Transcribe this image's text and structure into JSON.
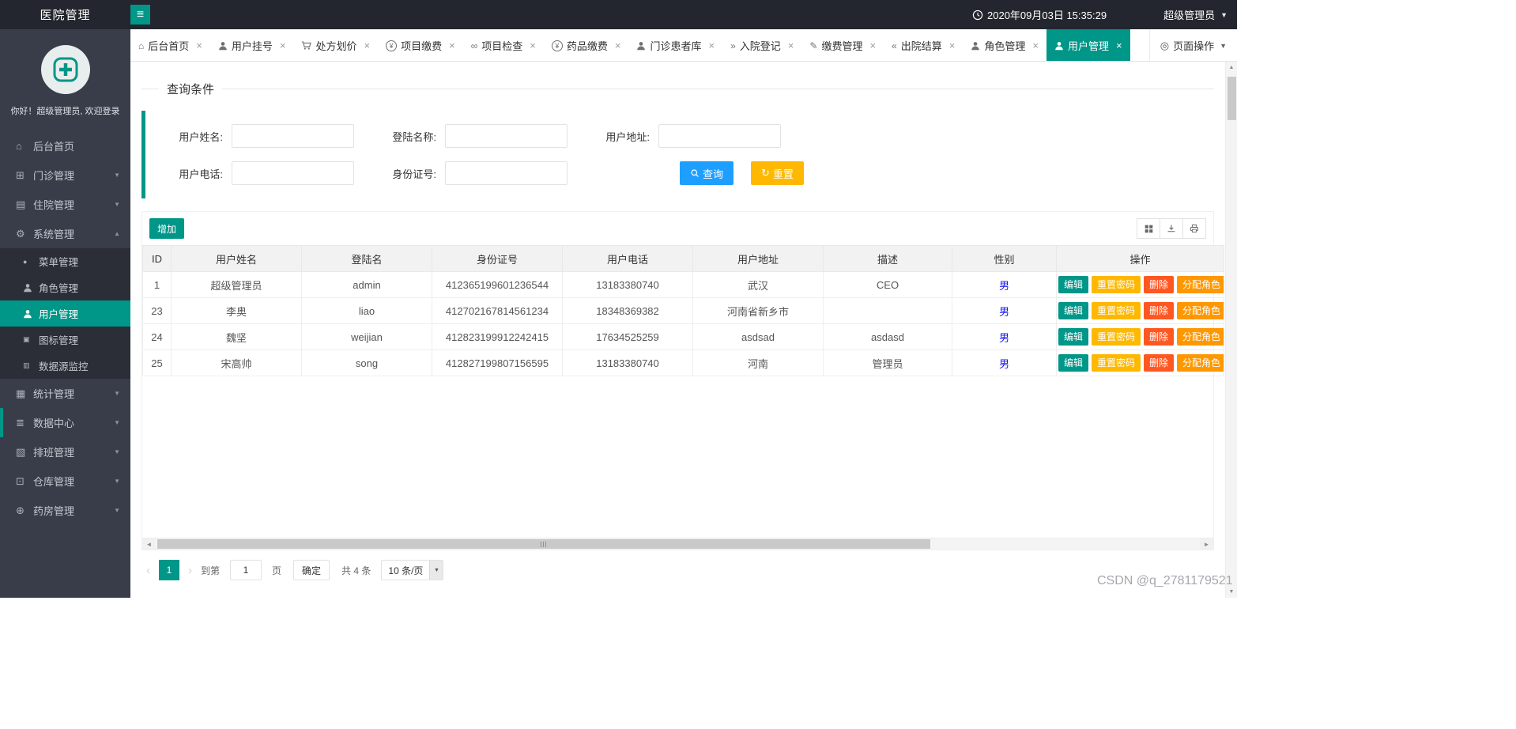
{
  "colors": {
    "accent": "#009688",
    "topbar_bg": "#23262E",
    "sidebar_bg": "#393D49",
    "search_blue": "#1E9FFF",
    "warn_yellow": "#FFB800",
    "danger_red": "#FF5722",
    "role_orange": "#FF9800",
    "gender_blue": "#1717EE"
  },
  "topbar": {
    "app_title": "医院管理",
    "hamburger_glyph": "≡",
    "datetime": "2020年09月03日 15:35:29",
    "username": "超级管理员",
    "caret_down": "▼"
  },
  "sidebar": {
    "greeting": "你好！超级管理员, 欢迎登录",
    "items": [
      {
        "label": "后台首页",
        "icon": "home-icon",
        "glyph": "⌂",
        "caret": ""
      },
      {
        "label": "门诊管理",
        "icon": "outpatient-icon",
        "glyph": "⊞",
        "caret": "▼"
      },
      {
        "label": "住院管理",
        "icon": "inpatient-icon",
        "glyph": "▤",
        "caret": "▼"
      },
      {
        "label": "系统管理",
        "icon": "gear-icon",
        "glyph": "⚙",
        "caret": "▲"
      },
      {
        "label": "统计管理",
        "icon": "chart-icon",
        "glyph": "▦",
        "caret": "▼"
      },
      {
        "label": "数据中心",
        "icon": "database-icon",
        "glyph": "≣",
        "caret": "▼"
      },
      {
        "label": "排班管理",
        "icon": "schedule-icon",
        "glyph": "▧",
        "caret": "▼"
      },
      {
        "label": "仓库管理",
        "icon": "warehouse-icon",
        "glyph": "⊡",
        "caret": "▼"
      },
      {
        "label": "药房管理",
        "icon": "pharmacy-icon",
        "glyph": "⊕",
        "caret": "▼"
      }
    ],
    "system_children": [
      {
        "label": "菜单管理",
        "icon": "dot-icon",
        "glyph": "●"
      },
      {
        "label": "角色管理",
        "icon": "role-icon"
      },
      {
        "label": "用户管理",
        "icon": "user-icon",
        "active": true
      },
      {
        "label": "图标管理",
        "icon": "image-icon",
        "glyph": "▣"
      },
      {
        "label": "数据源监控",
        "icon": "monitor-icon",
        "glyph": "▥"
      }
    ]
  },
  "tabbar": {
    "close_glyph": "×",
    "tabs": [
      {
        "label": "后台首页",
        "icon": "home-icon",
        "glyph": "⌂"
      },
      {
        "label": "用户挂号",
        "icon": "user-icon"
      },
      {
        "label": "处方划价",
        "icon": "cart-icon"
      },
      {
        "label": "项目缴费",
        "icon": "yen-icon",
        "glyph": "¥"
      },
      {
        "label": "项目检查",
        "icon": "link-icon",
        "glyph": "∞"
      },
      {
        "label": "药品缴费",
        "icon": "yen-icon",
        "glyph": "¥"
      },
      {
        "label": "门诊患者库",
        "icon": "patients-icon"
      },
      {
        "label": "入院登记",
        "icon": "admit-icon",
        "glyph": "»"
      },
      {
        "label": "缴费管理",
        "icon": "form-icon",
        "glyph": "✎"
      },
      {
        "label": "出院结算",
        "icon": "discharge-icon",
        "glyph": "«"
      },
      {
        "label": "角色管理",
        "icon": "role-icon"
      },
      {
        "label": "用户管理",
        "icon": "user-icon",
        "active": true
      }
    ],
    "page_ops": {
      "label": "页面操作",
      "icon": "target-icon",
      "glyph": "◎",
      "caret": "▼"
    }
  },
  "query": {
    "section_title": "查询条件",
    "fields": [
      {
        "label": "用户姓名:",
        "value": ""
      },
      {
        "label": "登陆名称:",
        "value": ""
      },
      {
        "label": "用户地址:",
        "value": ""
      },
      {
        "label": "用户电话:",
        "value": ""
      },
      {
        "label": "身份证号:",
        "value": ""
      }
    ],
    "search_button": "查询",
    "reset_button": "重置",
    "reset_glyph": "↻"
  },
  "toolbar": {
    "add_button": "增加"
  },
  "table": {
    "headers": [
      "ID",
      "用户姓名",
      "登陆名",
      "身份证号",
      "用户电话",
      "用户地址",
      "描述",
      "性别",
      "操作"
    ],
    "rows": [
      {
        "id": "1",
        "name": "超级管理员",
        "login": "admin",
        "idcard": "412365199601236544",
        "phone": "13183380740",
        "address": "武汉",
        "desc": "CEO",
        "gender": "男"
      },
      {
        "id": "23",
        "name": "李奥",
        "login": "liao",
        "idcard": "412702167814561234",
        "phone": "18348369382",
        "address": "河南省新乡市",
        "desc": "",
        "gender": "男"
      },
      {
        "id": "24",
        "name": "魏坚",
        "login": "weijian",
        "idcard": "412823199912242415",
        "phone": "17634525259",
        "address": "asdsad",
        "desc": "asdasd",
        "gender": "男"
      },
      {
        "id": "25",
        "name": "宋高帅",
        "login": "song",
        "idcard": "412827199807156595",
        "phone": "13183380740",
        "address": "河南",
        "desc": "管理员",
        "gender": "男"
      }
    ],
    "actions": [
      "编辑",
      "重置密码",
      "删除",
      "分配角色"
    ]
  },
  "pagination": {
    "prev_glyph": "‹",
    "next_glyph": "›",
    "current_page": "1",
    "goto_prefix": "到第",
    "goto_value": "1",
    "goto_suffix": "页",
    "confirm_button": "确定",
    "total_text": "共 4 条",
    "page_size": "10 条/页"
  },
  "scrollbars": {
    "up": "▲",
    "down": "▼",
    "left": "◄",
    "right": "►"
  },
  "watermark": "CSDN @q_2781179521"
}
